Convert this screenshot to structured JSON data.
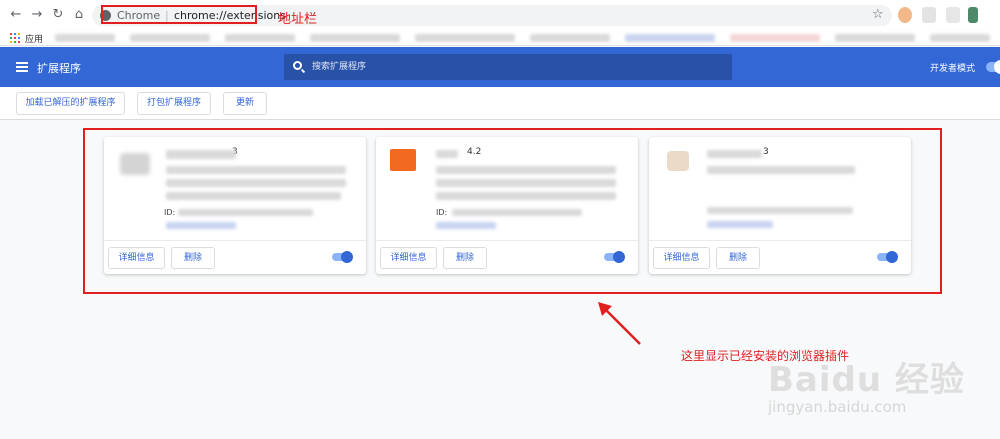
{
  "browser": {
    "url_scheme_label": "Chrome",
    "url_separator": "|",
    "url_path": "chrome://extensions"
  },
  "annotations": {
    "address_bar": "地址栏",
    "installed_note": "这里显示已经安装的浏览器插件"
  },
  "bookmarks": {
    "apps_label": "应用"
  },
  "header": {
    "title": "扩展程序",
    "search_placeholder": "搜索扩展程序",
    "dev_mode_label": "开发者模式"
  },
  "toolbar": {
    "load_unpacked": "加载已解压的扩展程序",
    "pack": "打包扩展程序",
    "update": "更新"
  },
  "cards": [
    {
      "version": "3",
      "id_label": "ID:",
      "details": "详细信息",
      "remove": "删除",
      "enabled": true,
      "logo_color": "#cfcfcf"
    },
    {
      "version": "4.2",
      "id_label": "ID:",
      "details": "详细信息",
      "remove": "删除",
      "enabled": true,
      "logo_color": "#f26a21"
    },
    {
      "version": "3",
      "id_label": "",
      "details": "详细信息",
      "remove": "删除",
      "enabled": true,
      "logo_color": "#e8d9c5"
    }
  ],
  "watermark": {
    "main": "Baidu 经验",
    "sub": "jingyan.baidu.com"
  },
  "colors": {
    "header_blue": "#3367d6",
    "annotation_red": "#e02020"
  }
}
